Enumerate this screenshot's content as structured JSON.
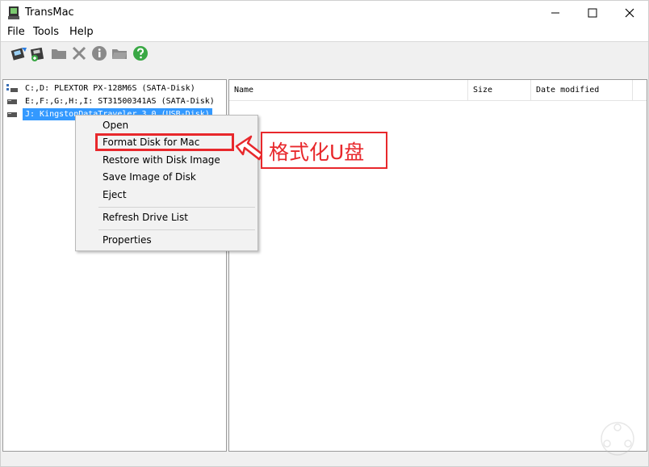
{
  "window": {
    "title": "TransMac",
    "controls": {
      "minimize": "—",
      "maximize": "☐",
      "close": "✕"
    }
  },
  "menubar": {
    "items": [
      "File",
      "Tools",
      "Help"
    ]
  },
  "toolbar": {
    "icons": [
      "open-disk-icon",
      "save-disk-icon",
      "folder-icon",
      "delete-icon",
      "info-icon",
      "folder-open-icon",
      "help-icon"
    ]
  },
  "drives": [
    {
      "label": "C:,D: PLEXTOR PX-128M6S (SATA-Disk)",
      "selected": false
    },
    {
      "label": "E:,F:,G:,H:,I: ST31500341AS (SATA-Disk)",
      "selected": false
    },
    {
      "label": "J: KingstonDataTraveler 3.0 (USB-Disk)",
      "selected": true
    }
  ],
  "list": {
    "columns": [
      "Name",
      "Size",
      "Date modified"
    ]
  },
  "context_menu": {
    "items": [
      "Open",
      "Format Disk for Mac",
      "Restore with Disk Image",
      "Save Image of Disk",
      "Eject",
      "Refresh Drive List",
      "Properties"
    ],
    "highlighted": "Format Disk for Mac"
  },
  "annotation": {
    "text": "格式化U盘",
    "color": "#e8282c"
  },
  "colors": {
    "selection": "#3399ff",
    "annotation": "#e8282c",
    "toolbar_green": "#3aa845"
  }
}
